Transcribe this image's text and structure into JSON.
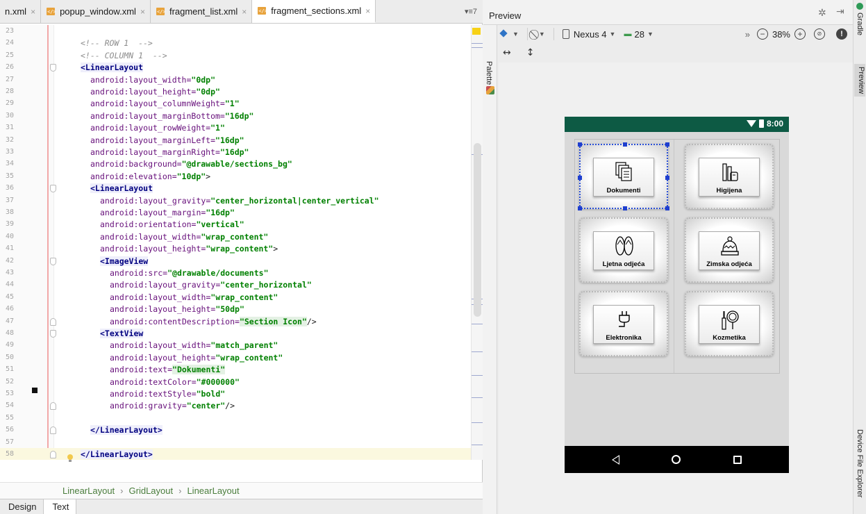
{
  "editor": {
    "tabs": [
      {
        "label": "n.xml",
        "close": "×"
      },
      {
        "label": "popup_window.xml",
        "close": "×"
      },
      {
        "label": "fragment_list.xml",
        "close": "×"
      },
      {
        "label": "fragment_sections.xml",
        "close": "×",
        "active": true
      }
    ],
    "tab_menu": "▾≡7",
    "lines": [
      {
        "n": "23",
        "text": ""
      },
      {
        "n": "24",
        "text": "<!-- ROW 1  -->",
        "kind": "comment"
      },
      {
        "n": "25",
        "text": "<!-- COLUMN 1  -->",
        "kind": "comment"
      },
      {
        "n": "26",
        "text": "<LinearLayout",
        "kind": "tag"
      },
      {
        "n": "27",
        "attr": "android:layout_width=",
        "val": "\"0dp\""
      },
      {
        "n": "28",
        "attr": "android:layout_height=",
        "val": "\"0dp\""
      },
      {
        "n": "29",
        "attr": "android:layout_columnWeight=",
        "val": "\"1\""
      },
      {
        "n": "30",
        "attr": "android:layout_marginBottom=",
        "val": "\"16dp\""
      },
      {
        "n": "31",
        "attr": "android:layout_rowWeight=",
        "val": "\"1\""
      },
      {
        "n": "32",
        "attr": "android:layout_marginLeft=",
        "val": "\"16dp\""
      },
      {
        "n": "33",
        "attr": "android:layout_marginRight=",
        "val": "\"16dp\""
      },
      {
        "n": "34",
        "attr": "android:background=",
        "val": "\"@drawable/sections_bg\""
      },
      {
        "n": "35",
        "attr": "android:elevation=",
        "val": "\"10dp\"",
        "tail": ">"
      },
      {
        "n": "36",
        "text": "<LinearLayout",
        "kind": "tag"
      },
      {
        "n": "37",
        "attr": "android:layout_gravity=",
        "val": "\"center_horizontal|center_vertical\""
      },
      {
        "n": "38",
        "attr": "android:layout_margin=",
        "val": "\"16dp\""
      },
      {
        "n": "39",
        "attr": "android:orientation=",
        "val": "\"vertical\""
      },
      {
        "n": "40",
        "attr": "android:layout_width=",
        "val": "\"wrap_content\""
      },
      {
        "n": "41",
        "attr": "android:layout_height=",
        "val": "\"wrap_content\"",
        "tail": ">"
      },
      {
        "n": "42",
        "text": "<ImageView",
        "kind": "tag"
      },
      {
        "n": "43",
        "attr": "android:src=",
        "val": "\"@drawable/documents\""
      },
      {
        "n": "44",
        "attr": "android:layout_gravity=",
        "val": "\"center_horizontal\""
      },
      {
        "n": "45",
        "attr": "android:layout_width=",
        "val": "\"wrap_content\""
      },
      {
        "n": "46",
        "attr": "android:layout_height=",
        "val": "\"50dp\""
      },
      {
        "n": "47",
        "attr": "android:contentDescription=",
        "val": "\"Section Icon\"",
        "tail": "/>",
        "hi": true
      },
      {
        "n": "48",
        "text": "<TextView",
        "kind": "tag"
      },
      {
        "n": "49",
        "attr": "android:layout_width=",
        "val": "\"match_parent\""
      },
      {
        "n": "50",
        "attr": "android:layout_height=",
        "val": "\"wrap_content\""
      },
      {
        "n": "51",
        "attr": "android:text=",
        "val": "\"Dokumenti\"",
        "hi": true
      },
      {
        "n": "52",
        "attr": "android:textColor=",
        "val": "\"#000000\""
      },
      {
        "n": "53",
        "attr": "android:textStyle=",
        "val": "\"bold\""
      },
      {
        "n": "54",
        "attr": "android:gravity=",
        "val": "\"center\"",
        "tail": "/>"
      },
      {
        "n": "55",
        "text": ""
      },
      {
        "n": "56",
        "text": "</LinearLayout>",
        "kind": "tag-close"
      },
      {
        "n": "57",
        "text": ""
      },
      {
        "n": "58",
        "text": "</LinearLayout>",
        "kind": "tag-close",
        "current": true
      },
      {
        "n": "59",
        "text": ""
      }
    ],
    "breadcrumb": [
      "LinearLayout",
      "GridLayout",
      "LinearLayout"
    ],
    "bottom_tabs": [
      "Design",
      "Text"
    ]
  },
  "preview": {
    "title": "Preview",
    "palette_label": "Palette",
    "device": "Nexus 4",
    "api": "28",
    "zoom": "38%",
    "more": "»",
    "zoom_out": "−",
    "zoom_in": "+",
    "warning": "!",
    "phone": {
      "time": "8:00",
      "cells": [
        {
          "label": "Dokumenti",
          "icon": "documents-icon",
          "selected": true
        },
        {
          "label": "Higijena",
          "icon": "hygiene-icon"
        },
        {
          "label": "Ljetna odjeća",
          "icon": "flip-flops-icon"
        },
        {
          "label": "Zimska odjeća",
          "icon": "winter-hat-icon"
        },
        {
          "label": "Elektronika",
          "icon": "plug-icon"
        },
        {
          "label": "Kozmetika",
          "icon": "cosmetics-icon"
        }
      ],
      "colors": {
        "statusbar": "#0d5a44",
        "selection": "#1f3fcf"
      }
    }
  },
  "side_tools": [
    "Gradle",
    "Preview",
    "Device File Explorer"
  ]
}
